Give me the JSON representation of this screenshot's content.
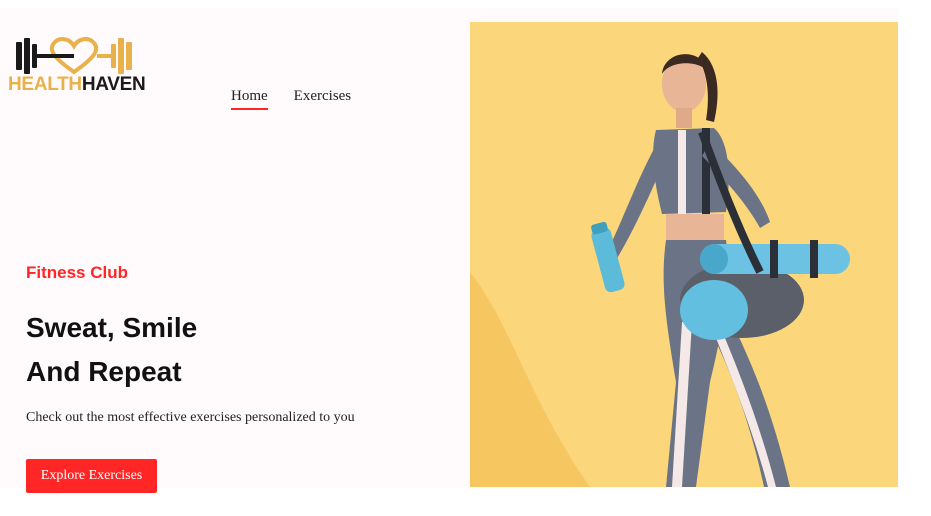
{
  "brand": {
    "part1": "HEALTH",
    "part2": "HAVEN"
  },
  "nav": {
    "items": [
      {
        "label": "Home",
        "active": true
      },
      {
        "label": "Exercises",
        "active": false
      }
    ]
  },
  "hero": {
    "eyebrow": "Fitness Club",
    "headline_line1": "Sweat, Smile",
    "headline_line2": "And Repeat",
    "subtitle": "Check out the most effective exercises personalized to you",
    "cta_label": "Explore Exercises",
    "image_alt": "woman walking with yoga mat and water bottle"
  },
  "colors": {
    "accent": "#ff2625",
    "logo_gold": "#e8b14a",
    "hero_bg": "#fcd67a"
  },
  "icons": {
    "logo": "dumbbell-heart-icon"
  }
}
